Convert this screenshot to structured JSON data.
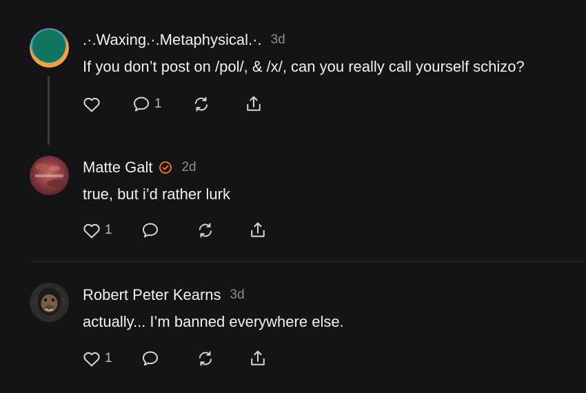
{
  "posts": [
    {
      "author": ".·.Waxing.·.Metaphysical.·.",
      "time": "3d",
      "text": "If you don’t post on /pol/, & /x/, can you really call yourself schizo?",
      "verified": false,
      "likes": "",
      "replies": "1"
    },
    {
      "author": "Matte Galt",
      "time": "2d",
      "text": "true, but i’d rather lurk",
      "verified": true,
      "likes": "1",
      "replies": ""
    },
    {
      "author": "Robert Peter Kearns",
      "time": "3d",
      "text": "actually... I’m banned everywhere else.",
      "verified": false,
      "likes": "1",
      "replies": ""
    }
  ],
  "icons": {
    "like": "heart-icon",
    "reply": "comment-icon",
    "repost": "repost-icon",
    "share": "share-icon",
    "verified": "verified-check-icon"
  },
  "colors": {
    "background": "#141416",
    "verified": "#ff7a1a",
    "secondary_text": "#8d8d8d"
  }
}
